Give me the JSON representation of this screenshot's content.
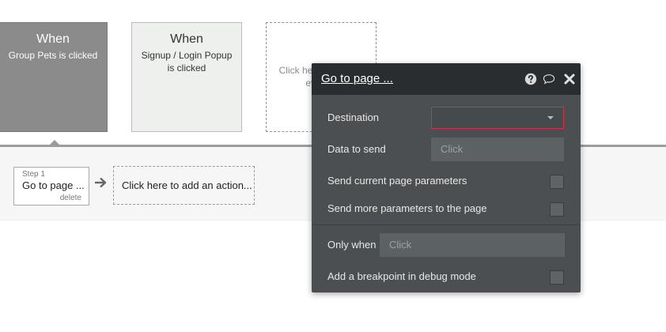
{
  "events": [
    {
      "when": "When",
      "description": "Group Pets is clicked"
    },
    {
      "when": "When",
      "description": "Signup / Login Popup is clicked"
    },
    {
      "add_label": "Click here to add an event..."
    }
  ],
  "workflow": {
    "step": {
      "label": "Step 1",
      "title": "Go to page ...",
      "delete": "delete"
    },
    "add_action": "Click here to add an action..."
  },
  "popup": {
    "title": "Go to page ...",
    "icons": [
      "help-icon",
      "comment-icon",
      "close-icon"
    ],
    "destination": {
      "label": "Destination",
      "value": ""
    },
    "data_to_send": {
      "label": "Data to send",
      "placeholder": "Click"
    },
    "send_current_params": {
      "label": "Send current page parameters",
      "checked": false
    },
    "send_more_params": {
      "label": "Send more parameters to the page",
      "checked": false
    },
    "only_when": {
      "label": "Only when",
      "placeholder": "Click"
    },
    "breakpoint": {
      "label": "Add a breakpoint in debug mode",
      "checked": false
    }
  },
  "colors": {
    "selected_event": "#8b8b8b",
    "popup_bg": "#4b4f51",
    "popup_header": "#2a2d2f",
    "invalid_border": "#d0304a"
  }
}
